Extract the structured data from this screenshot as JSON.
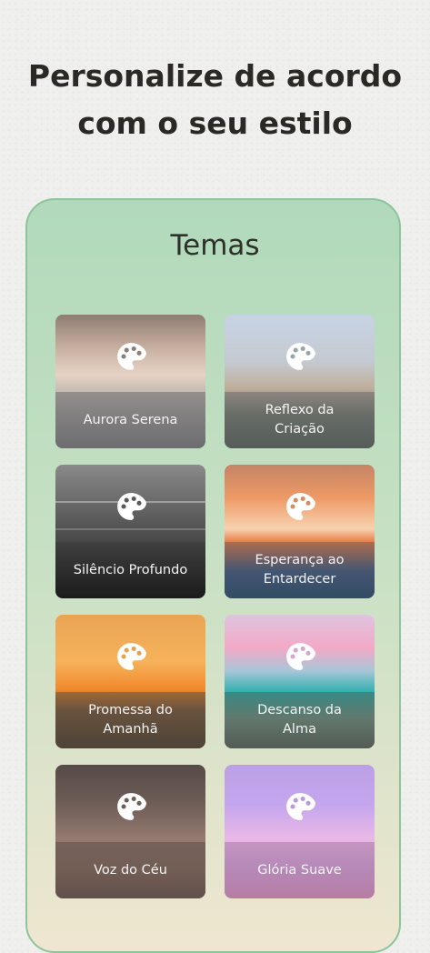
{
  "header": {
    "title": "Personalize de acordo com o seu estilo"
  },
  "themes": {
    "title": "Temas",
    "items": [
      {
        "label": "Aurora Serena",
        "icon": "palette-icon"
      },
      {
        "label": "Reflexo da Criação",
        "icon": "palette-icon"
      },
      {
        "label": "Silêncio Profundo",
        "icon": "palette-icon"
      },
      {
        "label": "Esperança ao Entardecer",
        "icon": "palette-icon"
      },
      {
        "label": "Promessa do Amanhã",
        "icon": "palette-icon"
      },
      {
        "label": "Descanso da Alma",
        "icon": "palette-icon"
      },
      {
        "label": "Voz do Céu",
        "icon": "palette-icon"
      },
      {
        "label": "Glória Suave",
        "icon": "palette-icon"
      }
    ]
  },
  "colors": {
    "panel_border": "#8dc49a",
    "panel_top": "#b1d9bb",
    "panel_bottom": "#efe6d0",
    "title_text": "#2b2925"
  }
}
